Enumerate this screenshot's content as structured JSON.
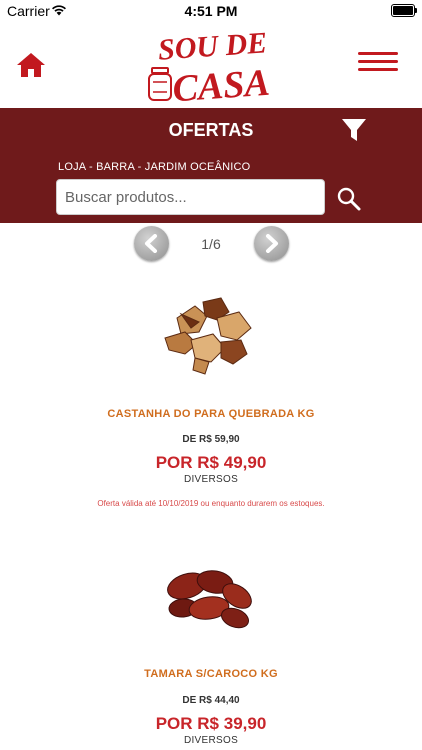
{
  "status_bar": {
    "carrier": "Carrier",
    "time": "4:51 PM"
  },
  "header": {
    "logo_top": "SOU DE",
    "logo_bottom": "CASA"
  },
  "banner": {
    "title": "OFERTAS",
    "store": "LOJA - BARRA - JARDIM OCEÂNICO",
    "search_placeholder": "Buscar produtos..."
  },
  "pagination": {
    "text": "1/6"
  },
  "products": [
    {
      "name": "CASTANHA DO PARA QUEBRADA KG",
      "old_price": "DE R$ 59,90",
      "price": "POR R$ 49,90",
      "category": "DIVERSOS",
      "note": "Oferta válida até 10/10/2019 ou enquanto durarem os estoques.",
      "image_icon": "brazil-nuts-image"
    },
    {
      "name": "TAMARA S/CAROCO KG",
      "old_price": "DE R$ 44,40",
      "price": "POR R$ 39,90",
      "category": "DIVERSOS",
      "image_icon": "dates-image"
    }
  ],
  "colors": {
    "brand_red": "#c2191f",
    "banner": "#6f1a1b",
    "price": "#c8252a",
    "product_name": "#d06d1e"
  }
}
